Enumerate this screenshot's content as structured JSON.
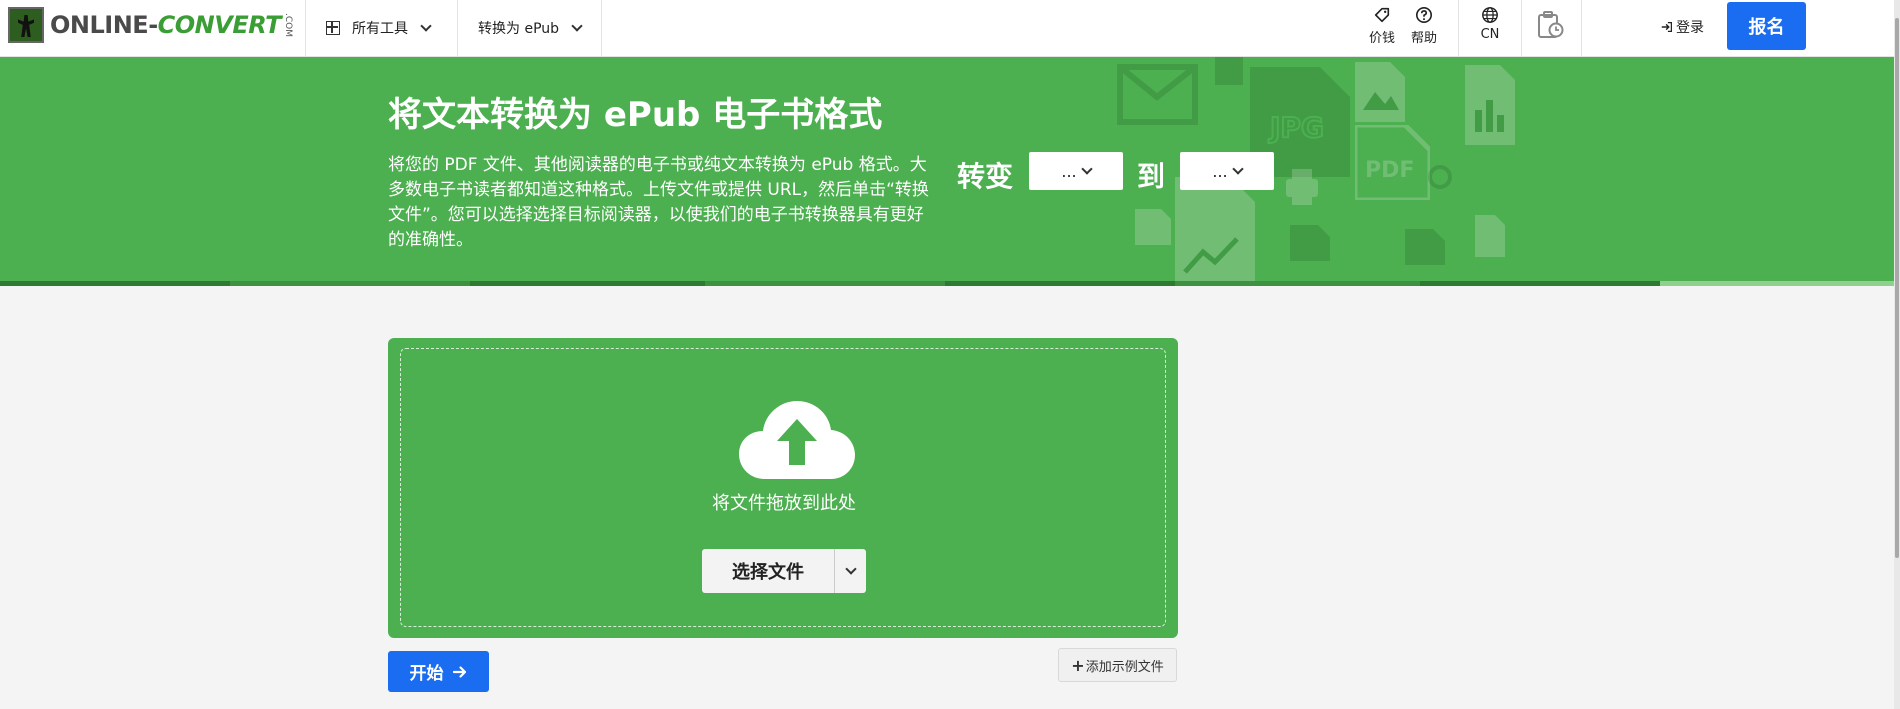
{
  "brand": {
    "logo_text_a": "ONLINE-",
    "logo_text_b": "CONVERT",
    "logo_com": ".COM"
  },
  "nav": {
    "all_tools": "所有工具",
    "convert_to": "转换为 ePub",
    "price": "价钱",
    "help": "帮助",
    "language": "CN",
    "login": "登录",
    "signup": "报名"
  },
  "hero": {
    "title": "将文本转换为 ePub 电子书格式",
    "description": "将您的 PDF 文件、其他阅读器的电子书或纯文本转换为 ePub 格式。大多数电子书读者都知道这种格式。上传文件或提供 URL，然后单击“转换文件”。您可以选择选择目标阅读器，以使我们的电子书转换器具有更好的准确性。",
    "convert_label": "转变",
    "to_label": "到",
    "from_select": "...",
    "to_select": "..."
  },
  "upload": {
    "drop_text": "将文件拖放到此处",
    "choose_label": "选择文件"
  },
  "actions": {
    "start": "开始",
    "add_sample": "添加示例文件"
  },
  "colors": {
    "green": "#4caf50",
    "blue": "#1a6cf0"
  }
}
